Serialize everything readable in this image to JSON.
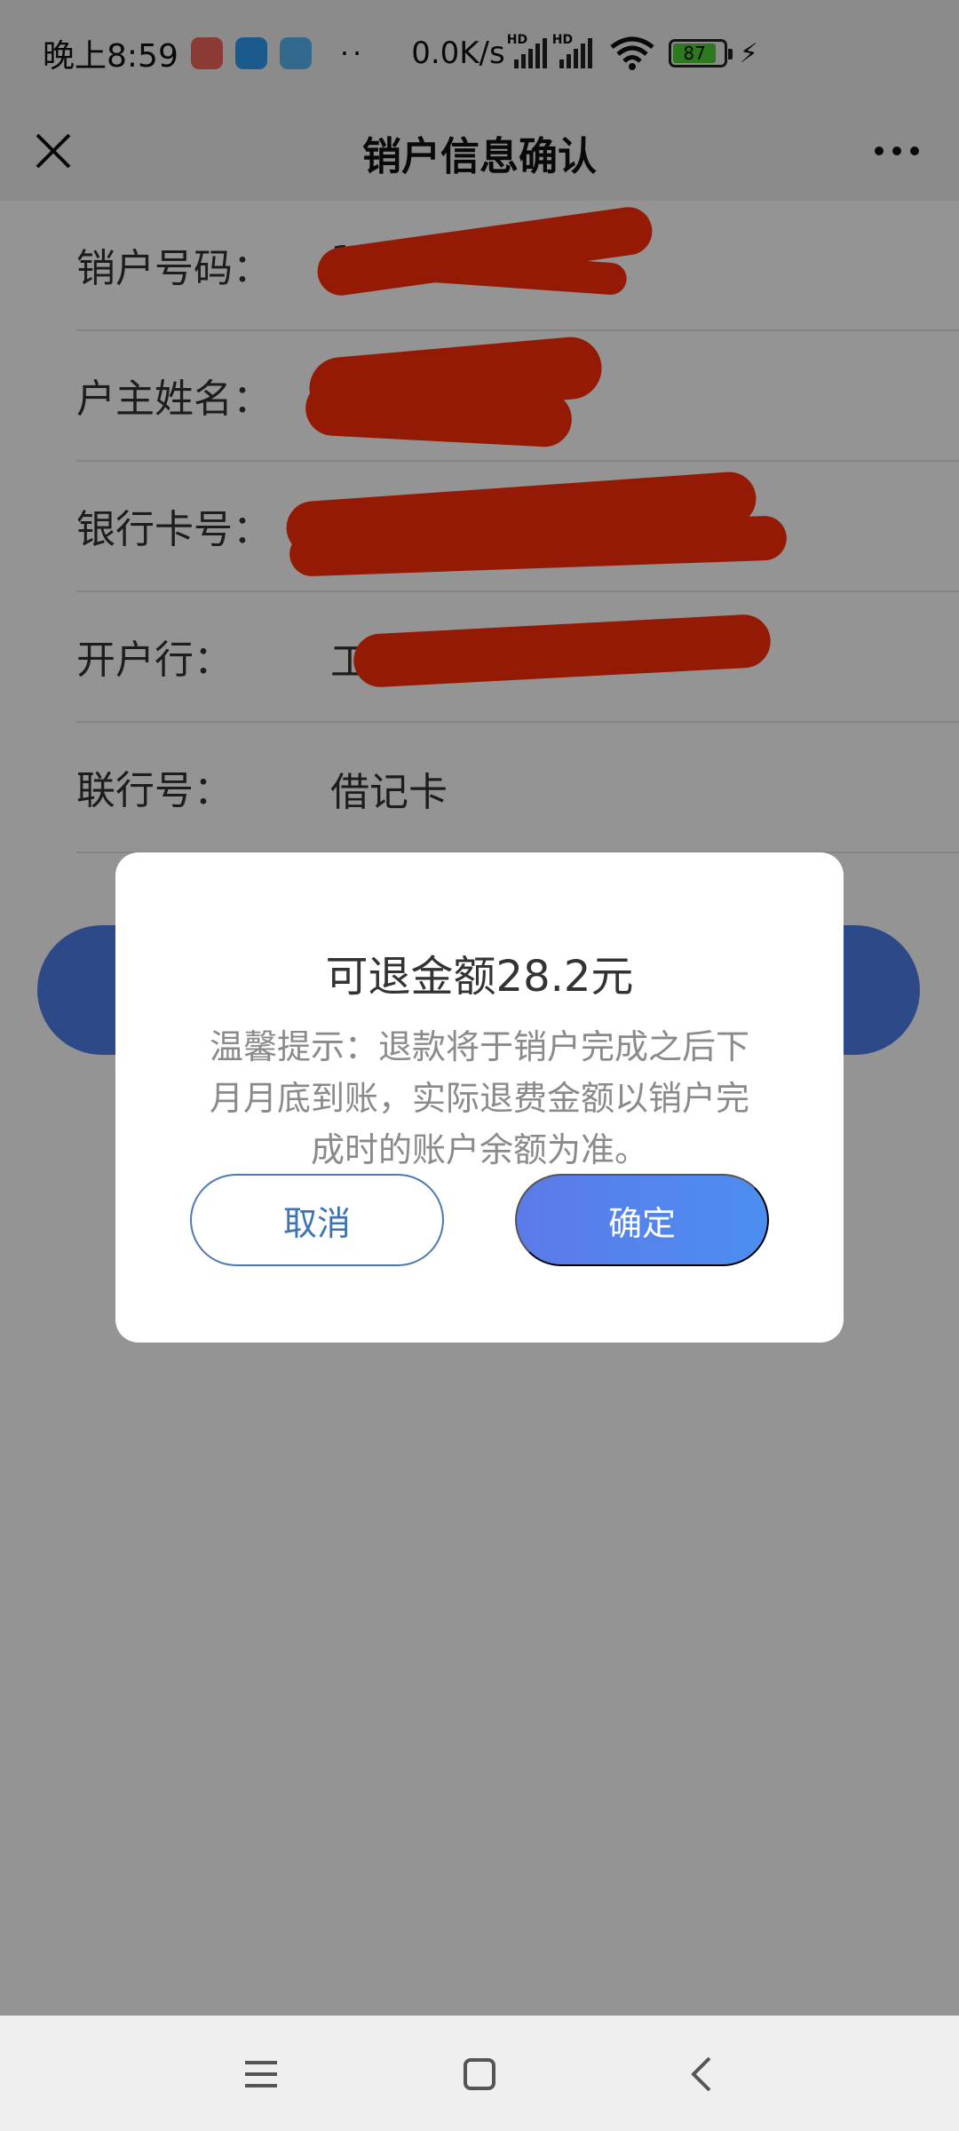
{
  "status_bar": {
    "time": "晚上8:59",
    "dots": "··",
    "net_speed": "0.0K/s",
    "hd1": "HD",
    "hd2": "HD",
    "battery_level": "87",
    "battery_fill_percent": 87
  },
  "header": {
    "title": "销户信息确认",
    "close_icon": "close-icon",
    "more_icon": "more-icon"
  },
  "form": {
    "rows": [
      {
        "label": "销户号码：",
        "value": "1702"
      },
      {
        "label": "户主姓名：",
        "value": ""
      },
      {
        "label": "银行卡号：",
        "value": ""
      },
      {
        "label": "开户行：",
        "value": "工"
      },
      {
        "label": "联行号：",
        "value": "借记卡"
      }
    ]
  },
  "dialog": {
    "title": "可退金额28.2元",
    "message": "温馨提示：退款将于销户完成之后下月月底到账，实际退费金额以销户完成时的账户余额为准。",
    "cancel_label": "取消",
    "confirm_label": "确定"
  },
  "nav_bar": {
    "items": [
      "menu-icon",
      "home-icon",
      "back-icon"
    ]
  },
  "colors": {
    "accent": "#4f7fe9",
    "redaction": "#ff2d0b",
    "overlay": "#000000"
  }
}
